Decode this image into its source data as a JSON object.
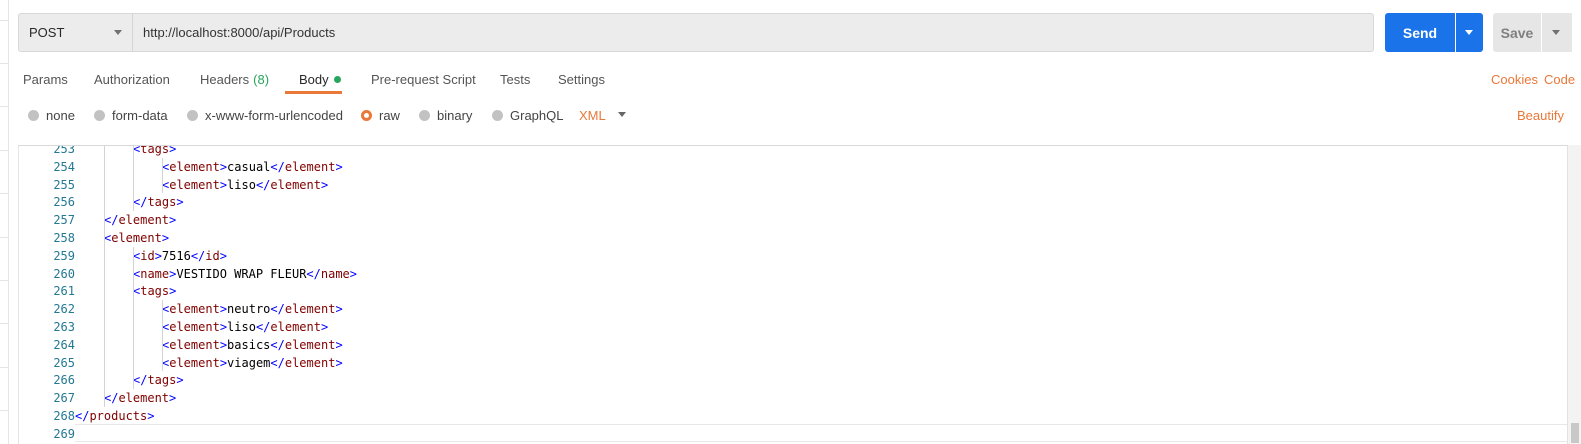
{
  "request": {
    "method": "POST",
    "url": "http://localhost:8000/api/Products",
    "send_label": "Send",
    "save_label": "Save"
  },
  "tabs": [
    {
      "label": "Params"
    },
    {
      "label": "Authorization"
    },
    {
      "label": "Headers",
      "count": "(8)"
    },
    {
      "label": "Body",
      "active": true,
      "indicator": "green-dot"
    },
    {
      "label": "Pre-request Script"
    },
    {
      "label": "Tests"
    },
    {
      "label": "Settings"
    }
  ],
  "right_links": {
    "cookies": "Cookies",
    "code": "Code",
    "beautify": "Beautify"
  },
  "body_types": {
    "options": [
      "none",
      "form-data",
      "x-www-form-urlencoded",
      "raw",
      "binary",
      "GraphQL"
    ],
    "selected": "raw",
    "language": "XML"
  },
  "colors": {
    "accent": "#e97839",
    "send_button": "#1a73e8",
    "tag": "#800000",
    "bracket": "#0000ff",
    "line_number": "#237893",
    "indicator": "#26a65b"
  },
  "editor": {
    "lines": [
      {
        "num": "253",
        "indent": 2,
        "tag": "tags",
        "kind": "open"
      },
      {
        "num": "254",
        "indent": 3,
        "tag": "element",
        "text": "casual"
      },
      {
        "num": "255",
        "indent": 3,
        "tag": "element",
        "text": "liso"
      },
      {
        "num": "256",
        "indent": 2,
        "tag": "tags",
        "kind": "close"
      },
      {
        "num": "257",
        "indent": 1,
        "tag": "element",
        "kind": "close"
      },
      {
        "num": "258",
        "indent": 1,
        "tag": "element",
        "kind": "open"
      },
      {
        "num": "259",
        "indent": 2,
        "tag": "id",
        "text": "7516"
      },
      {
        "num": "260",
        "indent": 2,
        "tag": "name",
        "text": "VESTIDO WRAP FLEUR"
      },
      {
        "num": "261",
        "indent": 2,
        "tag": "tags",
        "kind": "open"
      },
      {
        "num": "262",
        "indent": 3,
        "tag": "element",
        "text": "neutro"
      },
      {
        "num": "263",
        "indent": 3,
        "tag": "element",
        "text": "liso"
      },
      {
        "num": "264",
        "indent": 3,
        "tag": "element",
        "text": "basics"
      },
      {
        "num": "265",
        "indent": 3,
        "tag": "element",
        "text": "viagem"
      },
      {
        "num": "266",
        "indent": 2,
        "tag": "tags",
        "kind": "close"
      },
      {
        "num": "267",
        "indent": 1,
        "tag": "element",
        "kind": "close"
      },
      {
        "num": "268",
        "indent": 0,
        "tag": "products",
        "kind": "close"
      },
      {
        "num": "269",
        "indent": 0,
        "kind": "empty"
      }
    ]
  }
}
